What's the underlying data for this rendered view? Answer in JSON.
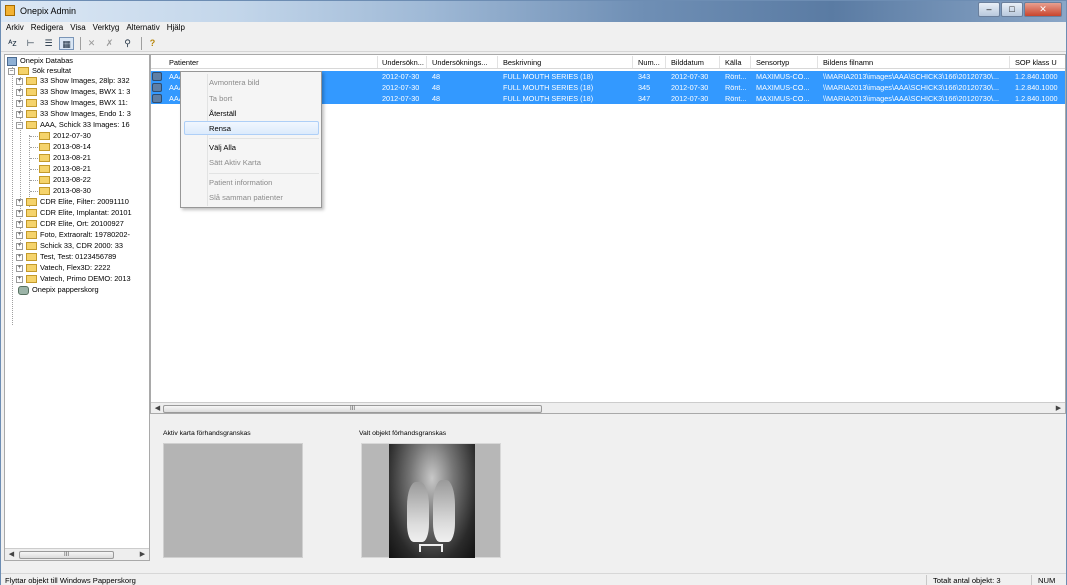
{
  "window": {
    "title": "Onepix Admin",
    "minimize": "–",
    "maximize": "□",
    "close": "✕"
  },
  "menu": [
    "Arkiv",
    "Redigera",
    "Visa",
    "Verktyg",
    "Alternativ",
    "Hjälp"
  ],
  "toolbar": {
    "buttons": [
      {
        "name": "sort-az-icon",
        "glyph": "ᴬᴢ"
      },
      {
        "name": "tree-view-icon",
        "glyph": "⊢"
      },
      {
        "name": "list-view-icon",
        "glyph": "☰"
      },
      {
        "name": "details-view-icon",
        "glyph": "▦"
      },
      {
        "name": "delete-icon",
        "glyph": "✕"
      },
      {
        "name": "clear-icon",
        "glyph": "✗"
      },
      {
        "name": "search-binoculars-icon",
        "glyph": "⚲"
      },
      {
        "name": "help-icon",
        "glyph": "?"
      }
    ]
  },
  "tree": {
    "root": "Onepix Databas",
    "search": "Sök resultat",
    "items": [
      "33 Show Images, 28lp: 332",
      "33 Show Images, BWX 1: 3",
      "33 Show Images, BWX 11:",
      "33 Show Images, Endo 1: 3",
      "AAA, Schick 33 Images: 16"
    ],
    "dates": [
      "2012-07-30",
      "2013-08-14",
      "2013-08-21",
      "2013-08-21",
      "2013-08-22",
      "2013-08-30"
    ],
    "more": [
      "CDR Elite, Filter: 20091110",
      "CDR Elite, Implantat: 20101",
      "CDR Elite, Ort: 20100927",
      "Foto, Extraoralt: 19780202-",
      "Schick 33, CDR 2000: 33",
      "Test, Test: 0123456789",
      "Vatech, Flex3D: 2222",
      "Vatech, Primo DEMO: 2013"
    ],
    "trash": "Onepix papperskorg",
    "scroll_thumb": "III"
  },
  "grid": {
    "headers": [
      "Patienter",
      "Undersökn...",
      "Undersöknings...",
      "Beskrivning",
      "Num...",
      "Bilddatum",
      "Källa",
      "Sensortyp",
      "Bildens filnamn",
      "SOP klass U"
    ],
    "rows": [
      {
        "patient": "AAA,",
        "date": "2012-07-30",
        "num": "48",
        "desc": "FULL MOUTH SERIES (18)",
        "n": "343",
        "bdate": "2012-07-30",
        "src": "Rönt...",
        "sensor": "MAXIMUS-CO...",
        "file": "\\\\MARIA2013\\images\\AAA\\SCHICK3\\166\\20120730\\...",
        "sop": "1.2.840.1000"
      },
      {
        "patient": "AAA,",
        "date": "2012-07-30",
        "num": "48",
        "desc": "FULL MOUTH SERIES (18)",
        "n": "345",
        "bdate": "2012-07-30",
        "src": "Rönt...",
        "sensor": "MAXIMUS-CO...",
        "file": "\\\\MARIA2013\\images\\AAA\\SCHICK3\\166\\20120730\\...",
        "sop": "1.2.840.1000"
      },
      {
        "patient": "AAA,",
        "date": "2012-07-30",
        "num": "48",
        "desc": "FULL MOUTH SERIES (18)",
        "n": "347",
        "bdate": "2012-07-30",
        "src": "Rönt...",
        "sensor": "MAXIMUS-CO...",
        "file": "\\\\MARIA2013\\images\\AAA\\SCHICK3\\166\\20120730\\...",
        "sop": "1.2.840.1000"
      }
    ],
    "scroll_thumb": "III"
  },
  "context_menu": {
    "items": [
      "Avmontera bild",
      "Ta bort",
      "Återställ",
      "Rensa",
      "Välj Alla",
      "Sätt Aktiv Karta",
      "Patient information",
      "Slå samman patienter"
    ]
  },
  "preview": {
    "active_label": "Aktiv karta förhandsgranskas",
    "selected_label": "Valt objekt förhandsgranskas"
  },
  "status": {
    "message": "Flyttar objekt till Windows Papperskorg",
    "total": "Totalt antal objekt: 3",
    "num": "NUM"
  },
  "colors": {
    "selection": "#3399ff",
    "highlight_border": "#aecff7"
  }
}
